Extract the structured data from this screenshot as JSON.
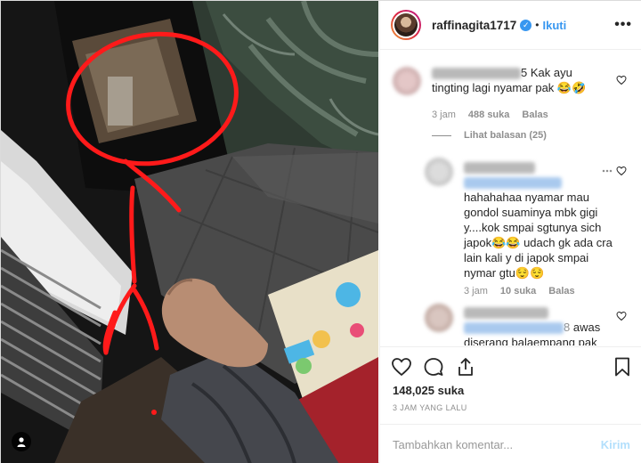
{
  "post": {
    "username": "raffinagita1717",
    "verified_icon": "verified-badge-icon",
    "separator": "•",
    "follow_label": "Ikuti",
    "more_label": "•••"
  },
  "comments": [
    {
      "username_visible": "5",
      "text_line1": "Kak ayu",
      "text_line2": "tingting lagi nyamar pak 😂🤣",
      "time": "3 jam",
      "likes": "488 suka",
      "reply_label": "Balas",
      "view_replies": "Lihat balasan (25)"
    },
    {
      "text": "hahahahaa nyamar mau gondol suaminya mbk gigi y....kok smpai sgtunya sich japok😂😂 udach gk ada cra lain kali y di japok smpai nymar gtu😌😌",
      "time": "3 jam",
      "likes": "10 suka",
      "reply_label": "Balas"
    },
    {
      "mention_suffix": "8",
      "text_after": "awas",
      "text_line2": "diserang balaempang pak"
    }
  ],
  "actions": {
    "likes_count": "148,025 suka",
    "time_ago": "3 JAM YANG LALU",
    "comment_placeholder": "Tambahkan komentar...",
    "post_label": "Kirim"
  },
  "colors": {
    "accent": "#3897f0",
    "scribble": "#ff1a1a",
    "muted": "#8e8e8e",
    "post_disabled": "#b2dffc"
  }
}
